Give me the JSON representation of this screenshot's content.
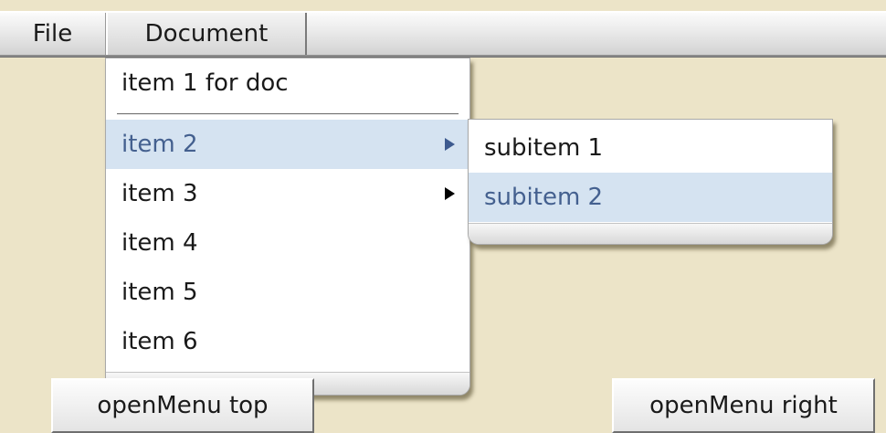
{
  "menubar": {
    "items": [
      {
        "label": "File"
      },
      {
        "label": "Document"
      }
    ]
  },
  "document_menu": {
    "items": [
      {
        "label": "item 1 for doc",
        "has_submenu": false
      },
      {
        "label": "item 2",
        "has_submenu": true,
        "highlighted": true
      },
      {
        "label": "item 3",
        "has_submenu": true
      },
      {
        "label": "item 4",
        "has_submenu": false
      },
      {
        "label": "item 5",
        "has_submenu": false
      },
      {
        "label": "item 6",
        "has_submenu": false
      }
    ]
  },
  "submenu": {
    "items": [
      {
        "label": "subitem 1"
      },
      {
        "label": "subitem 2",
        "highlighted": true
      }
    ]
  },
  "buttons": {
    "open_menu_top": "openMenu top",
    "open_menu_right": "openMenu right"
  },
  "colors": {
    "page_background": "#ece4c8",
    "highlight_background": "#d5e3f1",
    "highlight_text": "#44608f"
  },
  "icons": {
    "submenu_arrow": "triangle-right-icon"
  }
}
